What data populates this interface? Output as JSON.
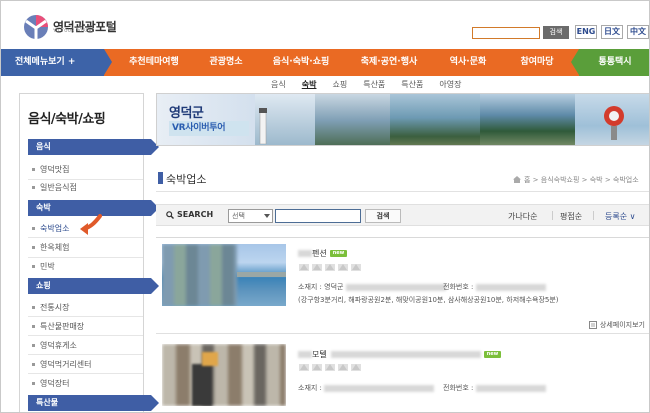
{
  "header": {
    "logo_text": "영덕관광포털",
    "logo_sub": "YD TOUR PORTAL",
    "search_button": "검색",
    "languages": [
      "ENG",
      "日文",
      "中文"
    ]
  },
  "topnav": {
    "all_menu": "전체메뉴보기 +",
    "items": [
      "추천테마여행",
      "관광명소",
      "음식·숙박·쇼핑",
      "축제·공연·행사",
      "역사·문화",
      "참여마당"
    ],
    "taxi": "통통택시"
  },
  "subnav": {
    "items": [
      "음식",
      "숙박",
      "쇼핑",
      "특산품",
      "특산품",
      "아영장"
    ],
    "active_index": 1
  },
  "sidebar": {
    "title": "음식/숙박/쇼핑",
    "cat_food": "음식",
    "food_items": [
      "영덕맛집",
      "일반음식점"
    ],
    "cat_stay": "숙박",
    "stay_items": [
      "숙박업소",
      "한옥체험",
      "민박"
    ],
    "cat_shop": "쇼핑",
    "shop_items": [
      "전통시장",
      "특산물판매장",
      "영덕휴게소",
      "영덕먹거리센터",
      "영덕장터"
    ],
    "cat_special": "특산물"
  },
  "banner": {
    "title": "영덕군",
    "subtitle": "VR사이버투어"
  },
  "content": {
    "title": "숙박업소",
    "breadcrumb": "홈 > 음식숙박쇼핑 > 숙박 > 숙박업소"
  },
  "searchbar": {
    "label": "SEARCH",
    "select_value": "선택",
    "button": "검색",
    "sort": [
      "가나다순",
      "평점순",
      "등록순 ∨"
    ]
  },
  "listings": [
    {
      "name": "펜션",
      "badge": "new",
      "address_label": "소재지 : 영덕군",
      "phone_label": "전화번호 :",
      "note": "(강구항3분거리, 해파랑공원2분, 해맞이공원10분, 삼사해상공원10분, 하저해수욕장5분)",
      "detail": "상세페이지보기"
    },
    {
      "name": "모텔",
      "badge": "new",
      "address_label": "소재지 :",
      "phone_label": "전화번호 :"
    }
  ],
  "colors": {
    "orange_nav": "#ea6a23",
    "blue_accent": "#3d63a8",
    "green_taxi": "#5a9e3a"
  }
}
